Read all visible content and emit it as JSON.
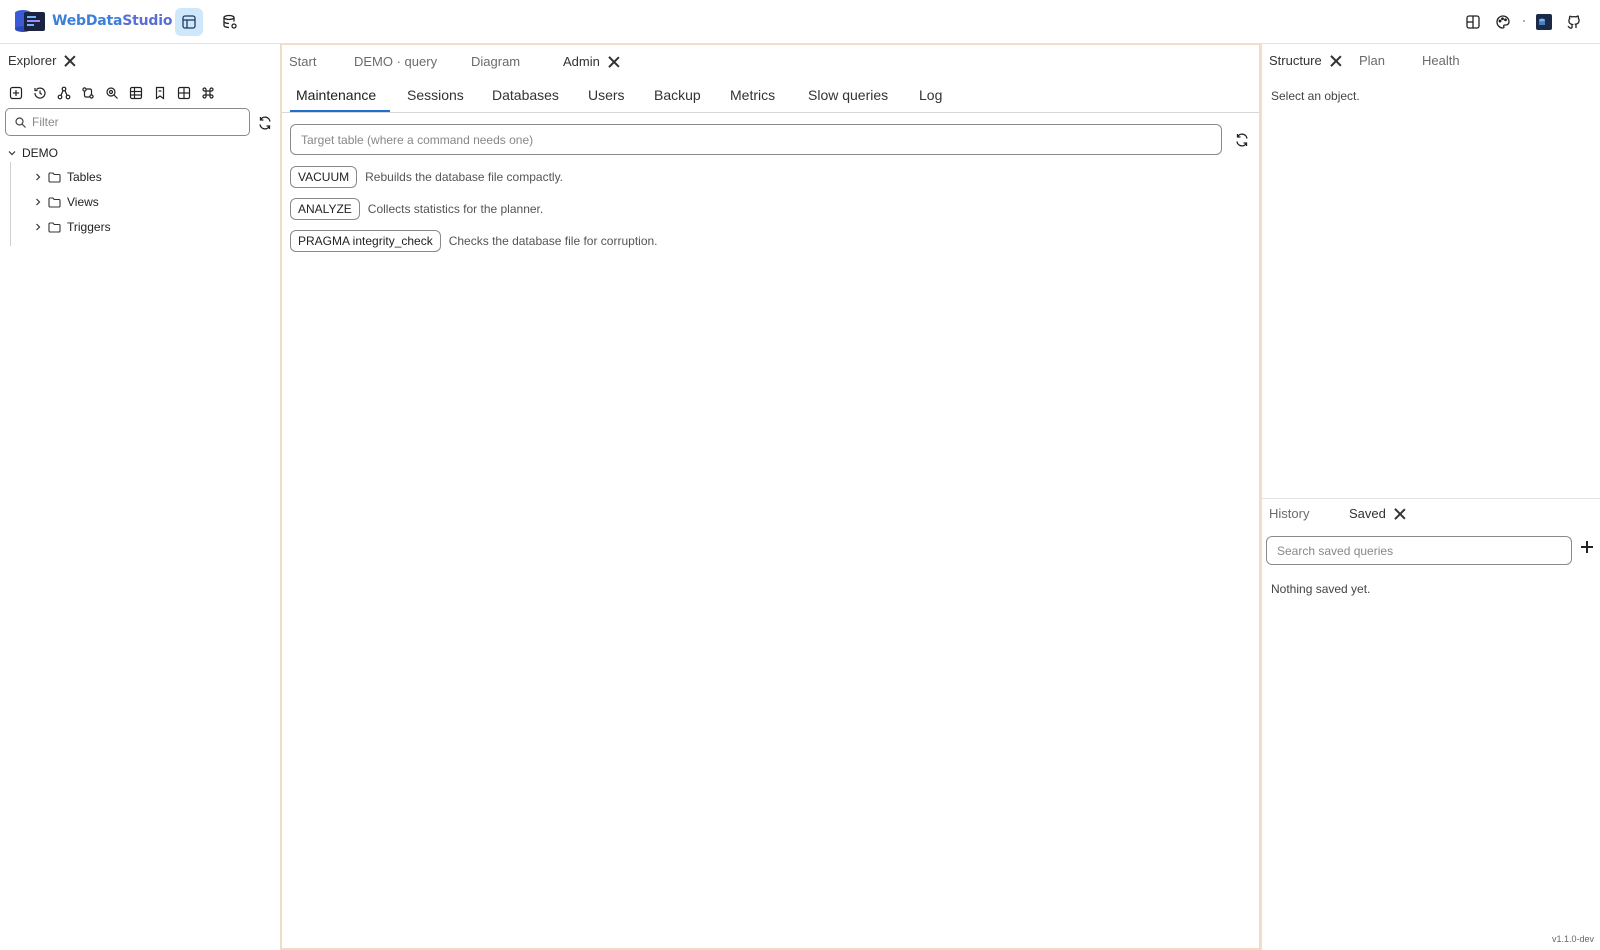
{
  "app": {
    "name_part1": "WebData",
    "name_part2": "Studio",
    "version": "v1.1.0-dev"
  },
  "topbar": {
    "left_buttons": [
      {
        "icon": "table-layout-icon",
        "active": true
      },
      {
        "icon": "database-settings-icon",
        "active": false
      }
    ],
    "right_buttons": [
      {
        "icon": "layout-icon"
      },
      {
        "icon": "palette-icon"
      },
      {
        "icon": "app-avatar-icon"
      },
      {
        "icon": "github-icon"
      }
    ]
  },
  "explorer": {
    "title": "Explorer",
    "tools": [
      "new-connection-icon",
      "history-icon",
      "diagram-icon",
      "swap-icon",
      "settings-search-icon",
      "table-icon",
      "bookmark-icon",
      "grid-plus-icon",
      "command-icon"
    ],
    "filter_placeholder": "Filter",
    "tree": {
      "root": "DEMO",
      "items": [
        "Tables",
        "Views",
        "Triggers"
      ]
    }
  },
  "center": {
    "doc_tabs": [
      {
        "label": "Start",
        "active": false
      },
      {
        "label": "DEMO · query",
        "active": false
      },
      {
        "label": "Diagram",
        "active": false
      },
      {
        "label": "Admin",
        "active": true
      }
    ],
    "sub_tabs": [
      "Maintenance",
      "Sessions",
      "Databases",
      "Users",
      "Backup",
      "Metrics",
      "Slow queries",
      "Log"
    ],
    "active_sub_tab": "Maintenance",
    "target_placeholder": "Target table (where a command needs one)",
    "commands": [
      {
        "label": "VACUUM",
        "desc": "Rebuilds the database file compactly."
      },
      {
        "label": "ANALYZE",
        "desc": "Collects statistics for the planner."
      },
      {
        "label": "PRAGMA integrity_check",
        "desc": "Checks the database file for corruption."
      }
    ]
  },
  "right": {
    "top_tabs": [
      "Structure",
      "Plan",
      "Health"
    ],
    "top_message": "Select an object.",
    "bottom_tabs": [
      "History",
      "Saved"
    ],
    "saved_search_placeholder": "Search saved queries",
    "saved_message": "Nothing saved yet."
  },
  "colors": {
    "accent": "#1f6fd1",
    "active_button_bg": "#cfe7fb",
    "panel_border": "#f0dcc4"
  }
}
